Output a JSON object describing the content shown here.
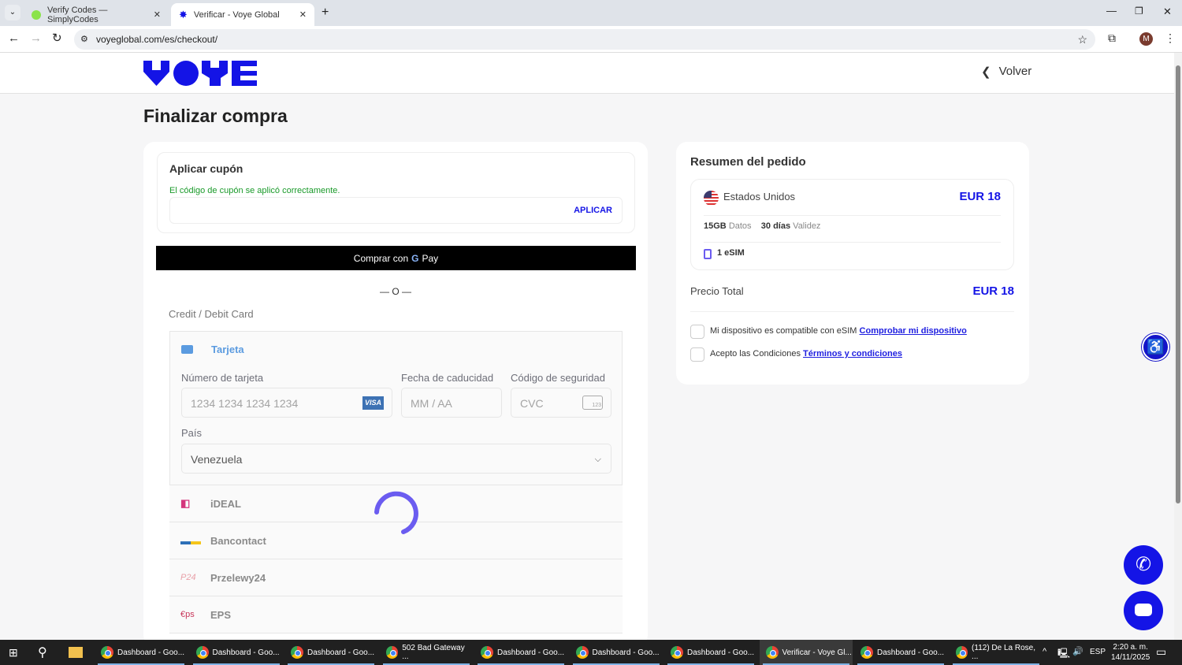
{
  "browser": {
    "tabs": [
      {
        "title": "Verify Codes — SimplyCodes"
      },
      {
        "title": "Verificar - Voye Global"
      }
    ],
    "url": "voyeglobal.com/es/checkout/",
    "profile": "M"
  },
  "header": {
    "logo": "VOYE",
    "back": "Volver"
  },
  "page": {
    "title": "Finalizar compra"
  },
  "coupon": {
    "title": "Aplicar cupón",
    "success": "El código de cupón se aplicó correctamente.",
    "input_value": "",
    "apply": "APLICAR"
  },
  "gpay": {
    "label": "Comprar con",
    "brand": "Pay"
  },
  "divider": "— O —",
  "payment": {
    "section": "Credit / Debit Card",
    "card_tab": "Tarjeta",
    "card_number_label": "Número de tarjeta",
    "card_number_placeholder": "1234 1234 1234 1234",
    "visa": "VISA",
    "expiry_label": "Fecha de caducidad",
    "expiry_placeholder": "MM / AA",
    "cvc_label": "Código de seguridad",
    "cvc_placeholder": "CVC",
    "cvc_icon_text": "123",
    "country_label": "País",
    "country_value": "Venezuela",
    "methods": [
      "iDEAL",
      "Bancontact",
      "Przelewy24",
      "EPS"
    ]
  },
  "summary": {
    "title": "Resumen del pedido",
    "country": "Estados Unidos",
    "price": "EUR 18",
    "data_amount": "15GB",
    "data_label": "Datos",
    "validity_amount": "30 días",
    "validity_label": "Validez",
    "esim": "1 eSIM",
    "total_label": "Precio Total",
    "total": "EUR 18",
    "check1_text": "Mi dispositivo es compatible con eSIM",
    "check1_link": "Comprobar mi dispositivo",
    "check2_text": "Acepto las Condiciones",
    "check2_link": "Términos y condiciones"
  },
  "taskbar": {
    "items": [
      {
        "label": "Dashboard - Goo...",
        "badge": "L"
      },
      {
        "label": "Dashboard - Goo...",
        "badge": "L"
      },
      {
        "label": "Dashboard - Goo...",
        "badge": "d"
      },
      {
        "label": "502 Bad Gateway ...",
        "badge": ""
      },
      {
        "label": "Dashboard - Goo...",
        "badge": "R"
      },
      {
        "label": "Dashboard - Goo...",
        "badge": "r"
      },
      {
        "label": "Dashboard - Goo...",
        "badge": "J"
      },
      {
        "label": "Verificar - Voye Gl...",
        "badge": "M"
      },
      {
        "label": "Dashboard - Goo...",
        "badge": "A"
      },
      {
        "label": "(112) De La Rose, ...",
        "badge": "P"
      }
    ],
    "lang": "ESP",
    "time": "2:20 a. m.",
    "date": "14/11/2025"
  },
  "colors": {
    "brand": "#1414e6",
    "accent": "#6b5cf0",
    "success": "#1a9a2a"
  }
}
